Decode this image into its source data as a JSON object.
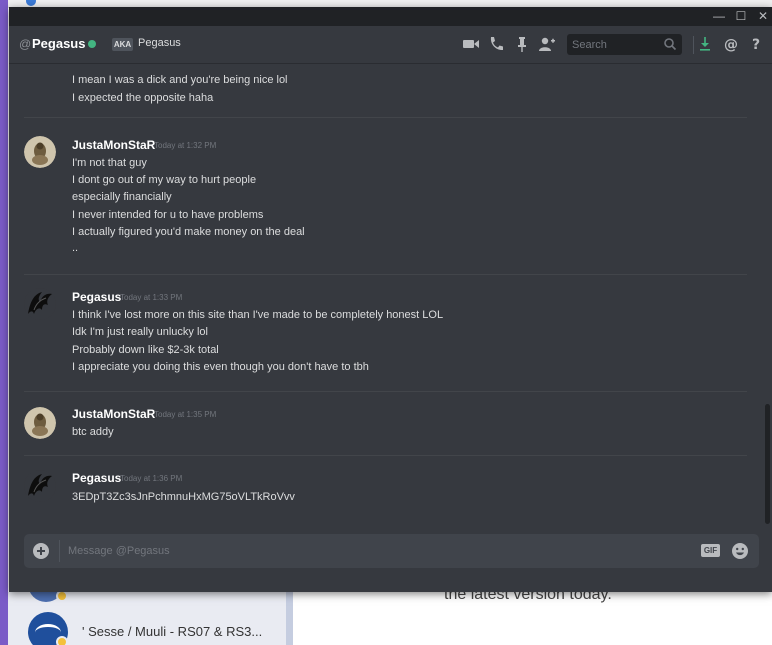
{
  "background_app": {
    "server_name": "' Sesse / Muuli - RS07 & RS3...",
    "update_text": "the latest version today."
  },
  "window": {
    "controls": {
      "minimize": "—",
      "maximize": "☐",
      "close": "✕"
    }
  },
  "header": {
    "at": "@",
    "name": "Pegasus",
    "aka_tag": "AKA",
    "aka_name": "Pegasus",
    "search_placeholder": "Search",
    "status_color": "#43b581",
    "icons": [
      "video-call-icon",
      "voice-call-icon",
      "pin-icon",
      "add-friend-icon",
      "search-icon",
      "download-icon",
      "mention-icon",
      "help-icon"
    ]
  },
  "messages": {
    "top_lines": [
      "I mean I was a dick and you're being nice lol",
      "I expected the opposite haha"
    ],
    "groups": [
      {
        "author": "JustaMonStaR",
        "time": "Today at 1:32 PM",
        "lines": [
          "I'm not that guy",
          "I dont go out of my way to hurt people",
          "especially financially",
          "I never intended for u to have problems",
          "I actually figured you'd make money on the deal",
          ".."
        ]
      },
      {
        "author": "Pegasus",
        "time": "Today at 1:33 PM",
        "lines": [
          "I think I've lost more on this site than I've made to be completely honest LOL",
          "Idk I'm just really unlucky lol",
          "Probably down like $2-3k total",
          "I appreciate you doing this even though you don't have to tbh"
        ]
      },
      {
        "author": "JustaMonStaR",
        "time": "Today at 1:35 PM",
        "lines": [
          "btc addy"
        ]
      },
      {
        "author": "Pegasus",
        "time": "Today at 1:36 PM",
        "lines": [
          "3EDpT3Zc3sJnPchmnuHxMG75oVLTkRoVvv"
        ]
      }
    ]
  },
  "composer": {
    "placeholder": "Message @Pegasus",
    "gif_label": "GIF"
  }
}
